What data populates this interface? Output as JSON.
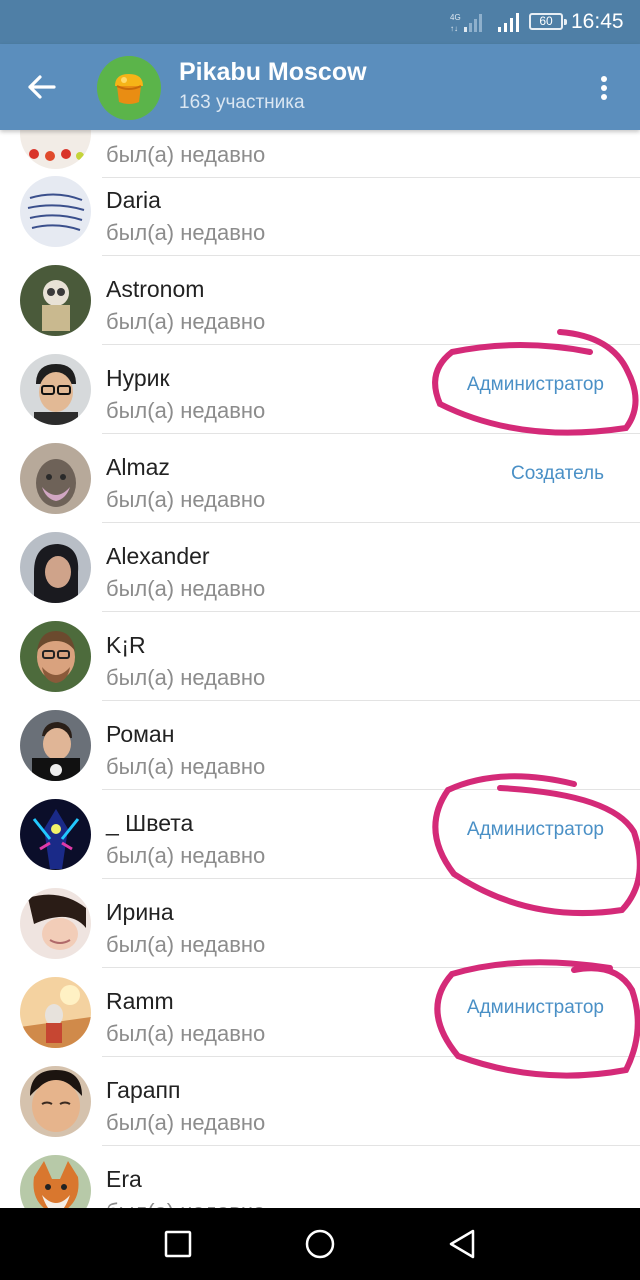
{
  "status_bar": {
    "network": "4G",
    "battery": "60",
    "time": "16:45"
  },
  "header": {
    "title": "Pikabu Moscow",
    "subtitle": "163 участника"
  },
  "members": [
    {
      "name": "",
      "status": "был(а) недавно",
      "role": ""
    },
    {
      "name": "Daria",
      "status": "был(а) недавно",
      "role": ""
    },
    {
      "name": "Astronom",
      "status": "был(а) недавно",
      "role": ""
    },
    {
      "name": "Нурик",
      "status": "был(а) недавно",
      "role": "Администратор"
    },
    {
      "name": "Almaz",
      "status": "был(а) недавно",
      "role": "Создатель"
    },
    {
      "name": "Alexander",
      "status": "был(а) недавно",
      "role": ""
    },
    {
      "name": "K¡R",
      "status": "был(а) недавно",
      "role": ""
    },
    {
      "name": "Роман",
      "status": "был(а) недавно",
      "role": ""
    },
    {
      "name": "_ Швета",
      "status": "был(а) недавно",
      "role": "Администратор"
    },
    {
      "name": "Ирина",
      "status": "был(а) недавно",
      "role": ""
    },
    {
      "name": "Ramm",
      "status": "был(а) недавно",
      "role": "Администратор"
    },
    {
      "name": "Гарапп",
      "status": "был(а) недавно",
      "role": ""
    },
    {
      "name": "Era",
      "status": "был(а) недавно",
      "role": ""
    }
  ],
  "colors": {
    "status_bar": "#4f7fa6",
    "app_bar": "#5b8ebd",
    "role_text": "#4a90c6",
    "annotation": "#d42a78"
  },
  "icons": {
    "back": "arrow-left-icon",
    "menu": "more-vertical-icon",
    "nav_recent": "square-icon",
    "nav_home": "circle-icon",
    "nav_back": "triangle-back-icon"
  }
}
